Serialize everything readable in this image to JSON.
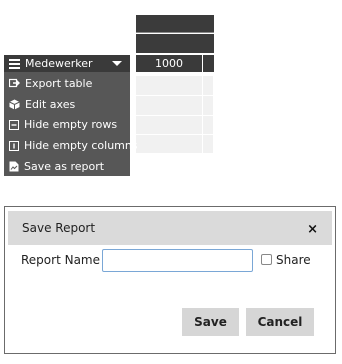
{
  "pivot": {
    "row_header_label": "Medewerker",
    "column_value": "1000"
  },
  "menu": {
    "items": [
      {
        "label": "Export table",
        "icon": "export-icon"
      },
      {
        "label": "Edit axes",
        "icon": "cube-icon"
      },
      {
        "label": "Hide empty rows",
        "icon": "minus-square-icon"
      },
      {
        "label": "Hide empty columns",
        "icon": "columns-icon"
      },
      {
        "label": "Save as report",
        "icon": "save-report-icon"
      }
    ]
  },
  "dialog": {
    "title": "Save Report",
    "close_symbol": "×",
    "name_label": "Report Name",
    "name_value": "",
    "share_label": "Share",
    "share_checked": false,
    "save_label": "Save",
    "cancel_label": "Cancel"
  }
}
